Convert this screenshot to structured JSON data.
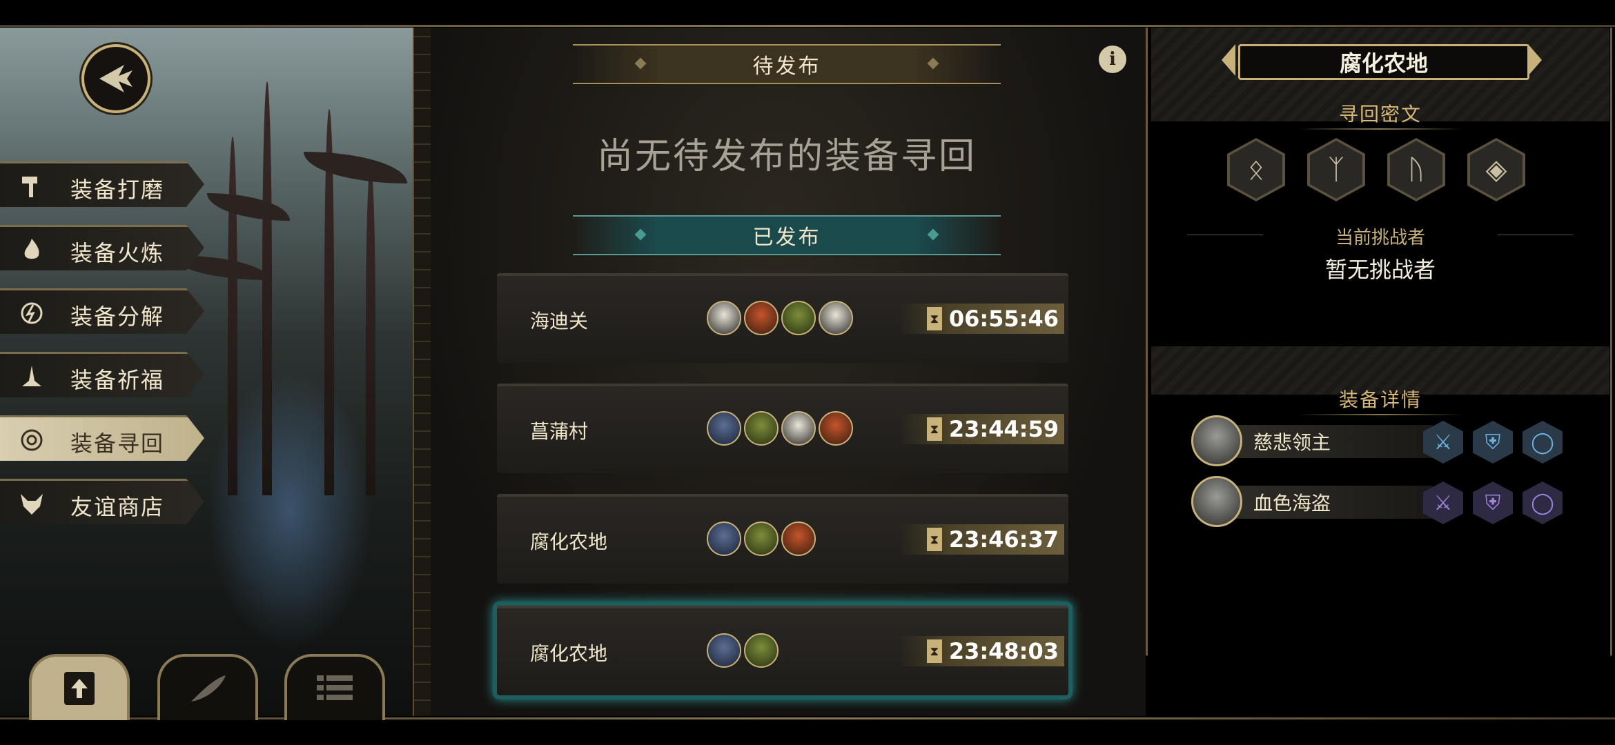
{
  "menu": {
    "items": [
      {
        "label": "装备打磨",
        "icon": "hammer-icon",
        "active": false
      },
      {
        "label": "装备火炼",
        "icon": "flame-icon",
        "active": false
      },
      {
        "label": "装备分解",
        "icon": "dissolve-icon",
        "active": false
      },
      {
        "label": "装备祈福",
        "icon": "pray-icon",
        "active": false
      },
      {
        "label": "装备寻回",
        "icon": "target-icon",
        "active": true
      },
      {
        "label": "友谊商店",
        "icon": "fox-icon",
        "active": false
      }
    ]
  },
  "pending": {
    "header": "待发布",
    "empty_message": "尚无待发布的装备寻回"
  },
  "published": {
    "header": "已发布",
    "cards": [
      {
        "name": "海迪关",
        "portraits": [
          "white",
          "red",
          "green",
          "white"
        ],
        "timer": "06:55:46",
        "selected": false
      },
      {
        "name": "菖蒲村",
        "portraits": [
          "blue",
          "green",
          "white",
          "red"
        ],
        "timer": "23:44:59",
        "selected": false
      },
      {
        "name": "腐化农地",
        "portraits": [
          "blue",
          "green",
          "red"
        ],
        "timer": "23:46:37",
        "selected": false
      },
      {
        "name": "腐化农地",
        "portraits": [
          "blue",
          "green"
        ],
        "timer": "23:48:03",
        "selected": true
      }
    ]
  },
  "detail": {
    "region": "腐化农地",
    "runes_title": "寻回密文",
    "runes": [
      "ᛟ",
      "ᛉ",
      "ᚢ",
      "◈"
    ],
    "challenger_label": "当前挑战者",
    "challenger_value": "暂无挑战者",
    "equipment_title": "装备详情",
    "bosses": [
      {
        "name": "慈悲领主",
        "gear_color": "blue"
      },
      {
        "name": "血色海盗",
        "gear_color": "purple"
      }
    ]
  },
  "colors": {
    "accent_gold": "#c9b27a",
    "teal": "#2a8b88"
  }
}
